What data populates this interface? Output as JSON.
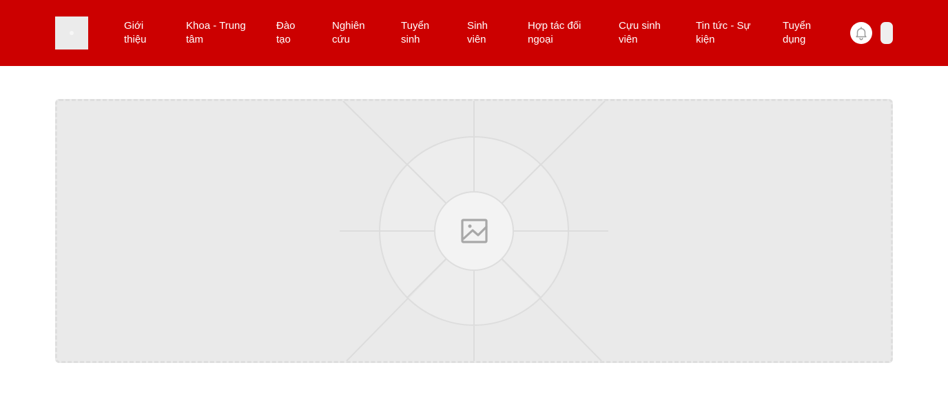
{
  "header": {
    "background_color": "#cc0000",
    "logo_icon": "logo-placeholder",
    "nav": [
      {
        "label": "Giới thiệu"
      },
      {
        "label": "Khoa - Trung tâm"
      },
      {
        "label": "Đào tạo"
      },
      {
        "label": "Nghiên cứu"
      },
      {
        "label": "Tuyển sinh"
      },
      {
        "label": "Sinh viên"
      },
      {
        "label": "Hợp tác đối ngoại"
      },
      {
        "label": "Cựu sinh viên"
      },
      {
        "label": "Tin tức - Sự kiện"
      },
      {
        "label": "Tuyển dụng"
      }
    ],
    "notification_icon": "bell-icon"
  },
  "banner": {
    "icon": "image-placeholder-icon"
  }
}
